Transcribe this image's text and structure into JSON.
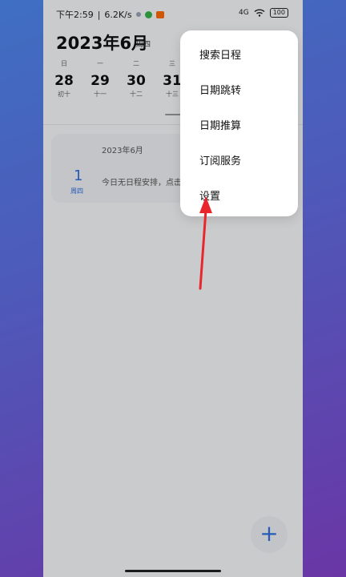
{
  "status_bar": {
    "time": "下午2:59",
    "separator": "|",
    "speed": "6.2K/s",
    "battery": "100",
    "signal": "4G"
  },
  "header": {
    "month_title": "2023年6月",
    "weekday": "周四"
  },
  "week": [
    {
      "wd": "日",
      "num": "28",
      "lunar": "初十"
    },
    {
      "wd": "一",
      "num": "29",
      "lunar": "十一"
    },
    {
      "wd": "二",
      "num": "30",
      "lunar": "十二"
    },
    {
      "wd": "三",
      "num": "31",
      "lunar": "十三"
    }
  ],
  "card": {
    "month": "2023年6月",
    "day_num": "1",
    "weekday": "周四",
    "message": "今日无日程安排，点击"
  },
  "menu": {
    "items": [
      "搜索日程",
      "日期跳转",
      "日期推算",
      "订阅服务",
      "设置"
    ]
  },
  "fab": {
    "label": "+"
  },
  "colors": {
    "accent": "#2f6fe0",
    "arrow": "#e8262b"
  }
}
